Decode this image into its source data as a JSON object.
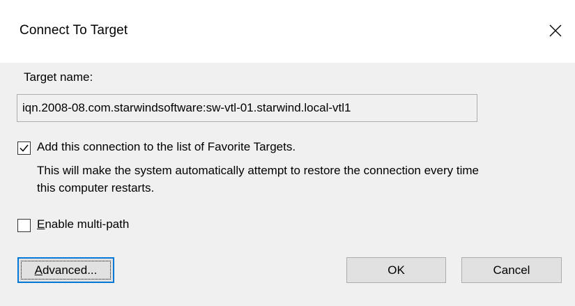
{
  "window": {
    "title": "Connect To Target",
    "close_icon": "close-icon"
  },
  "target": {
    "label": "Target name:",
    "value": "iqn.2008-08.com.starwindsoftware:sw-vtl-01.starwind.local-vtl1"
  },
  "favorite": {
    "checked": true,
    "label": "Add this connection to the list of Favorite Targets.",
    "description": "This will make the system automatically attempt to restore the connection every time this computer restarts."
  },
  "multipath": {
    "checked": false,
    "label_mnemonic": "E",
    "label_rest": "nable multi-path"
  },
  "buttons": {
    "advanced_mnemonic": "A",
    "advanced_rest": "dvanced...",
    "ok": "OK",
    "cancel": "Cancel"
  },
  "colors": {
    "background": "#f0f0f0",
    "titlebar": "#ffffff",
    "button_face": "#e1e1e1",
    "focus_border": "#0078d7"
  }
}
